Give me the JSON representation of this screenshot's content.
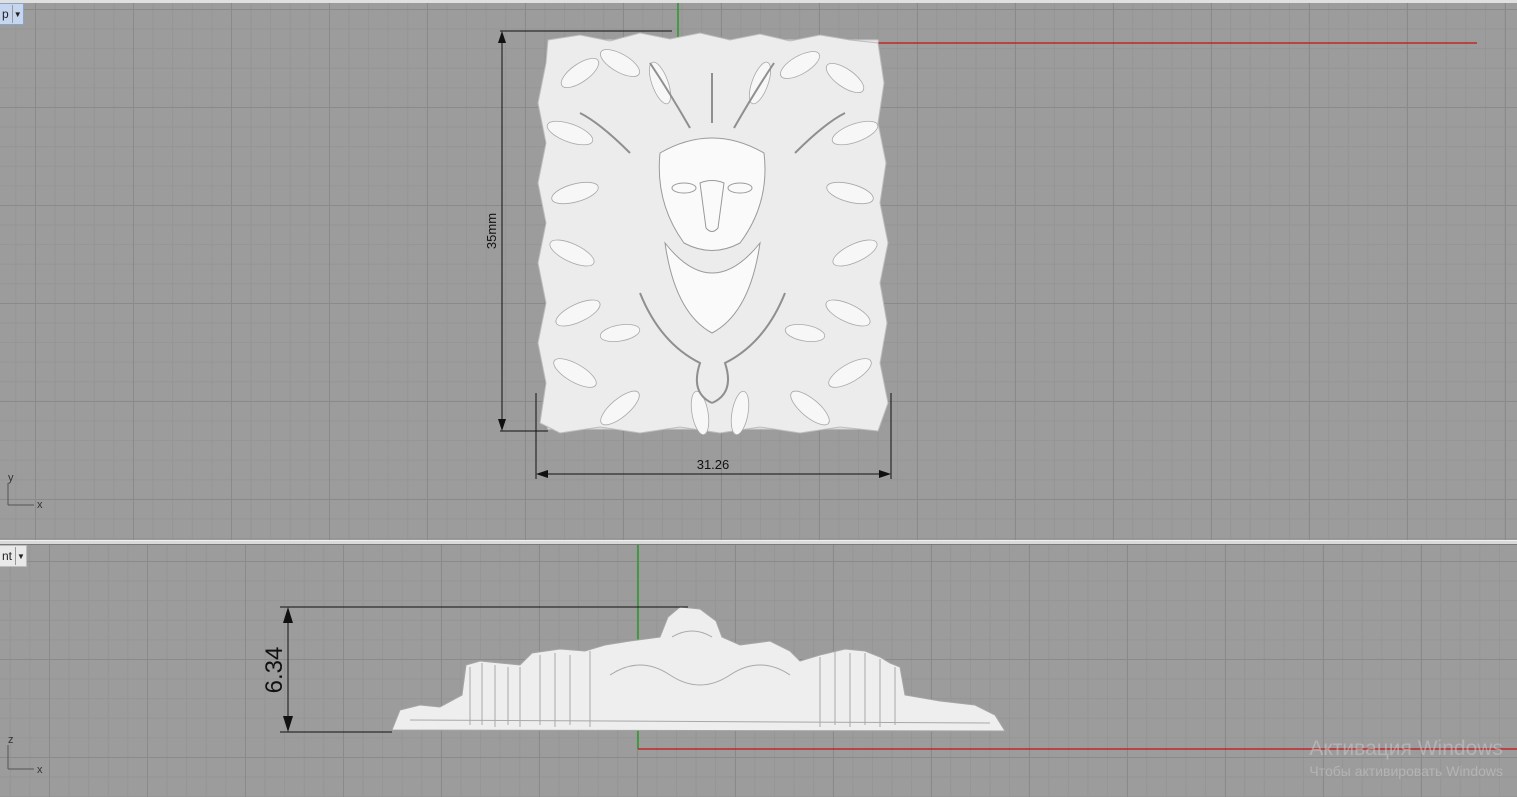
{
  "viewports": {
    "top": {
      "label": "p",
      "dim_height": "35mm",
      "dim_width": "31.26",
      "axis_y": "y",
      "axis_x": "x"
    },
    "front": {
      "label": "nt",
      "dim_height": "6.34",
      "axis_z": "z",
      "axis_x": "x"
    }
  },
  "watermark": {
    "line1": "Активация Windows",
    "line2": "Чтобы активировать Windows"
  },
  "colors": {
    "grid_bg": "#9c9c9c",
    "x_axis": "#c0262a",
    "y_axis": "#2a9a2a",
    "model": "#f2f2f2"
  }
}
